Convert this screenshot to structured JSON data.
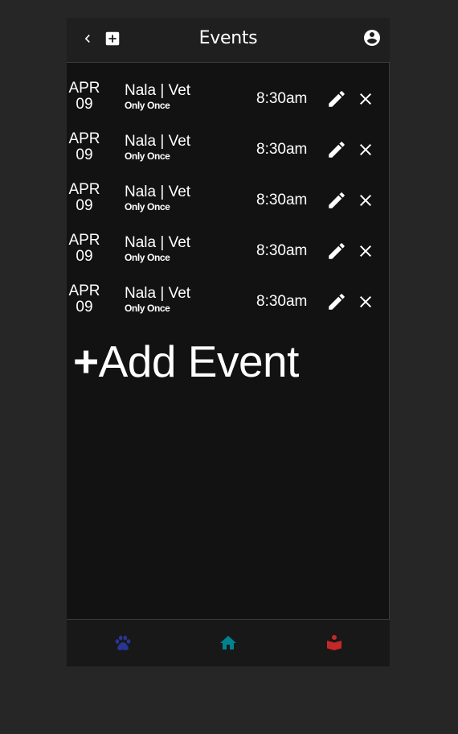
{
  "header": {
    "title": "Events",
    "back_icon": "chevron-left-icon",
    "add_icon": "plus-box-icon",
    "account_icon": "account-circle-icon"
  },
  "events": [
    {
      "month": "APR",
      "day": "09",
      "name": "Nala | Vet",
      "frequency": "Only Once",
      "time": "8:30am"
    },
    {
      "month": "APR",
      "day": "09",
      "name": "Nala | Vet",
      "frequency": "Only Once",
      "time": "8:30am"
    },
    {
      "month": "APR",
      "day": "09",
      "name": "Nala | Vet",
      "frequency": "Only Once",
      "time": "8:30am"
    },
    {
      "month": "APR",
      "day": "09",
      "name": "Nala | Vet",
      "frequency": "Only Once",
      "time": "8:30am"
    },
    {
      "month": "APR",
      "day": "09",
      "name": "Nala | Vet",
      "frequency": "Only Once",
      "time": "8:30am"
    }
  ],
  "add_event": {
    "plus": "+",
    "label": "Add Event"
  },
  "bottom_nav": [
    {
      "icon": "paw-icon",
      "color": "#283593"
    },
    {
      "icon": "home-icon",
      "color": "#00838f"
    },
    {
      "icon": "book-reader-icon",
      "color": "#c62828"
    }
  ],
  "colors": {
    "background": "#262626",
    "screen": "#121212",
    "bar": "#1f1f1f",
    "text": "#ffffff"
  }
}
